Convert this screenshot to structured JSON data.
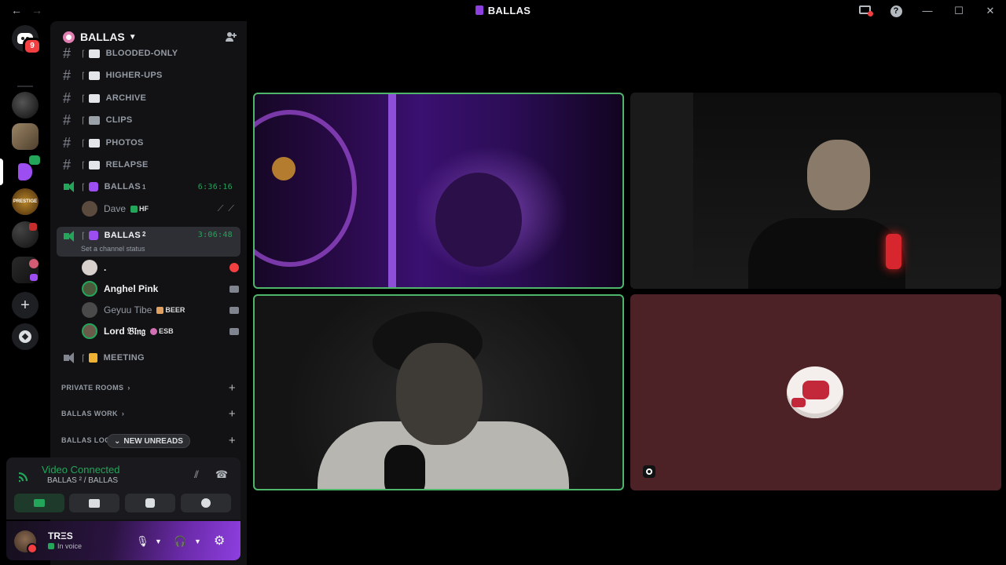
{
  "titlebar": {
    "title": "BALLAS",
    "back": "←",
    "forward": "→"
  },
  "rail": {
    "home_badge": "9",
    "server_s4_label": "PRESTIGE"
  },
  "server": {
    "name": "BALLAS"
  },
  "channels": [
    {
      "name": "BLOODED-ONLY"
    },
    {
      "name": "HIGHER-UPS"
    },
    {
      "name": "ARCHIVE"
    },
    {
      "name": "CLIPS"
    },
    {
      "name": "PHOTOS"
    },
    {
      "name": "RELAPSE"
    }
  ],
  "voice1": {
    "name": "BALLAS",
    "sup": "1",
    "timer": "6:36:16"
  },
  "voice1_user": {
    "name": "Dave",
    "tag": "HF"
  },
  "voice2": {
    "name": "BALLAS",
    "sup": "2",
    "timer": "3:06:48",
    "status": "Set a channel status"
  },
  "voice2_users": [
    {
      "name": "."
    },
    {
      "name": "Anghel Pink"
    },
    {
      "name": "Geyuu Tibe",
      "tag": "BEER"
    },
    {
      "name": "Lord 𝔅𝔩𝔫𝔤",
      "tag": "ESB"
    }
  ],
  "voice3": {
    "name": "MEETING"
  },
  "categories": [
    {
      "name": "PRIVATE ROOMS"
    },
    {
      "name": "BALLAS WORK"
    },
    {
      "name": "BALLAS LOGS"
    }
  ],
  "new_unreads": "NEW UNREADS",
  "voice_panel": {
    "title": "Video Connected",
    "subtitle": "BALLAS ² / BALLAS"
  },
  "user_panel": {
    "name": "TRΞS",
    "status": "In voice"
  },
  "colors": {
    "accent_green": "#23a55a",
    "danger": "#f23f42",
    "brand_purple": "#8e3fe0"
  }
}
